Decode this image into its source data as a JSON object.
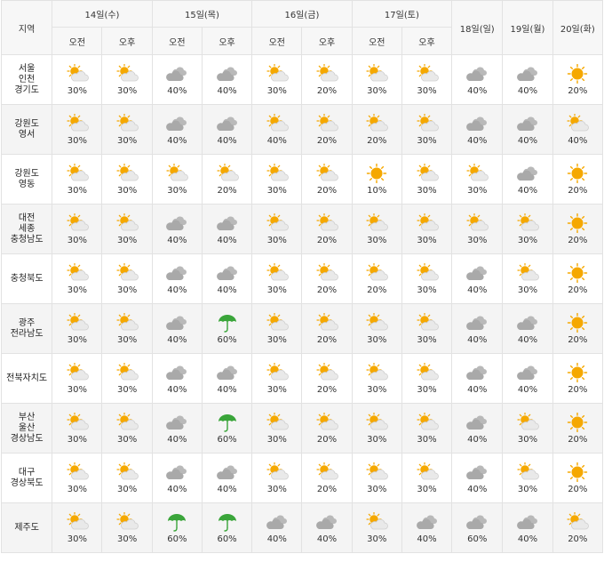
{
  "header": {
    "region_label": "지역",
    "am": "오전",
    "pm": "오후",
    "split_days": [
      "14일(수)",
      "15일(목)",
      "16일(금)",
      "17일(토)"
    ],
    "single_days": [
      "18일(일)",
      "19일(월)",
      "20일(화)"
    ]
  },
  "legend_icons": {
    "P": "partly-cloudy-icon",
    "C": "cloudy-icon",
    "R": "rain-umbrella-icon",
    "S": "sunny-icon"
  },
  "colors": {
    "sun": "#f5a800",
    "cloud": "#a9a9a9",
    "umbrella": "#3aa53a"
  },
  "rows": [
    {
      "region": [
        "서울",
        "인천",
        "경기도"
      ],
      "icons": [
        "P",
        "P",
        "C",
        "C",
        "P",
        "P",
        "P",
        "P",
        "C",
        "C",
        "S"
      ],
      "pct": [
        "30%",
        "30%",
        "40%",
        "40%",
        "30%",
        "20%",
        "30%",
        "30%",
        "40%",
        "40%",
        "20%"
      ]
    },
    {
      "region": [
        "강원도",
        "영서"
      ],
      "icons": [
        "P",
        "P",
        "C",
        "C",
        "P",
        "P",
        "P",
        "P",
        "C",
        "C",
        "P"
      ],
      "pct": [
        "30%",
        "30%",
        "40%",
        "40%",
        "40%",
        "20%",
        "20%",
        "30%",
        "40%",
        "40%",
        "40%"
      ]
    },
    {
      "region": [
        "강원도",
        "영동"
      ],
      "icons": [
        "P",
        "P",
        "P",
        "P",
        "P",
        "P",
        "S",
        "P",
        "P",
        "C",
        "S"
      ],
      "pct": [
        "30%",
        "30%",
        "30%",
        "20%",
        "30%",
        "20%",
        "10%",
        "30%",
        "30%",
        "40%",
        "20%"
      ]
    },
    {
      "region": [
        "대전",
        "세종",
        "충청남도"
      ],
      "icons": [
        "P",
        "P",
        "C",
        "C",
        "P",
        "P",
        "P",
        "P",
        "P",
        "P",
        "S"
      ],
      "pct": [
        "30%",
        "30%",
        "40%",
        "40%",
        "30%",
        "20%",
        "30%",
        "30%",
        "30%",
        "30%",
        "20%"
      ]
    },
    {
      "region": [
        "충청북도"
      ],
      "icons": [
        "P",
        "P",
        "C",
        "C",
        "P",
        "P",
        "P",
        "P",
        "C",
        "P",
        "S"
      ],
      "pct": [
        "30%",
        "30%",
        "40%",
        "40%",
        "30%",
        "20%",
        "20%",
        "30%",
        "40%",
        "30%",
        "20%"
      ]
    },
    {
      "region": [
        "광주",
        "전라남도"
      ],
      "icons": [
        "P",
        "P",
        "C",
        "R",
        "P",
        "P",
        "P",
        "P",
        "C",
        "C",
        "S"
      ],
      "pct": [
        "30%",
        "30%",
        "40%",
        "60%",
        "30%",
        "20%",
        "30%",
        "30%",
        "40%",
        "40%",
        "20%"
      ]
    },
    {
      "region": [
        "전북자치도"
      ],
      "icons": [
        "P",
        "P",
        "C",
        "C",
        "P",
        "P",
        "P",
        "P",
        "C",
        "C",
        "S"
      ],
      "pct": [
        "30%",
        "30%",
        "40%",
        "40%",
        "30%",
        "20%",
        "30%",
        "30%",
        "40%",
        "40%",
        "20%"
      ]
    },
    {
      "region": [
        "부산",
        "울산",
        "경상남도"
      ],
      "icons": [
        "P",
        "P",
        "C",
        "R",
        "P",
        "P",
        "P",
        "P",
        "C",
        "P",
        "S"
      ],
      "pct": [
        "30%",
        "30%",
        "40%",
        "60%",
        "30%",
        "20%",
        "30%",
        "30%",
        "40%",
        "30%",
        "20%"
      ]
    },
    {
      "region": [
        "대구",
        "경상북도"
      ],
      "icons": [
        "P",
        "P",
        "C",
        "C",
        "P",
        "P",
        "P",
        "P",
        "C",
        "P",
        "S"
      ],
      "pct": [
        "30%",
        "30%",
        "40%",
        "40%",
        "30%",
        "20%",
        "30%",
        "30%",
        "40%",
        "30%",
        "20%"
      ]
    },
    {
      "region": [
        "제주도"
      ],
      "icons": [
        "P",
        "P",
        "R",
        "R",
        "C",
        "C",
        "P",
        "C",
        "C",
        "C",
        "P"
      ],
      "pct": [
        "30%",
        "30%",
        "60%",
        "60%",
        "40%",
        "40%",
        "30%",
        "40%",
        "60%",
        "40%",
        "20%"
      ]
    }
  ]
}
